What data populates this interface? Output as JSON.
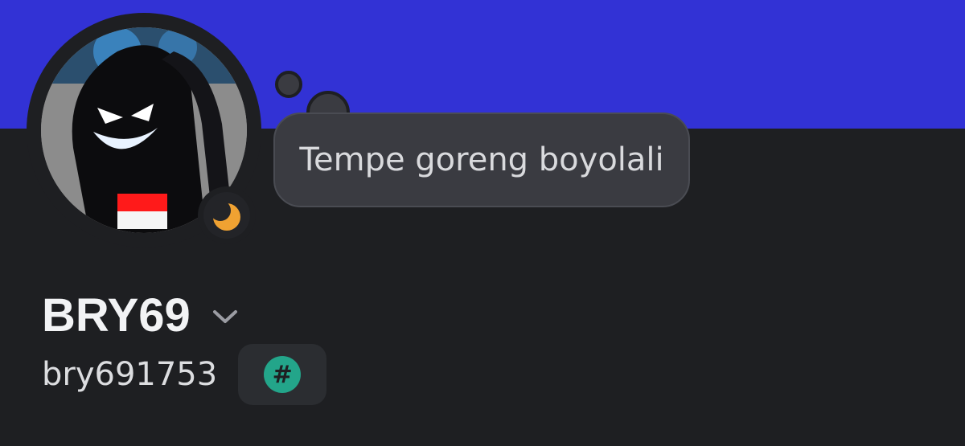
{
  "profile": {
    "display_name": "BRY69",
    "username": "bry691753",
    "custom_status": "Tempe goreng boyolali",
    "status": "idle",
    "tag_badge_symbol": "#"
  },
  "icons": {
    "status": "moon-icon",
    "expand": "chevron-down-icon",
    "badge": "hash-icon"
  },
  "colors": {
    "banner": "#3232d5",
    "background": "#1e1f22",
    "status_idle": "#f0a232",
    "badge_accent": "#23a58a",
    "bubble": "#3a3b41"
  }
}
